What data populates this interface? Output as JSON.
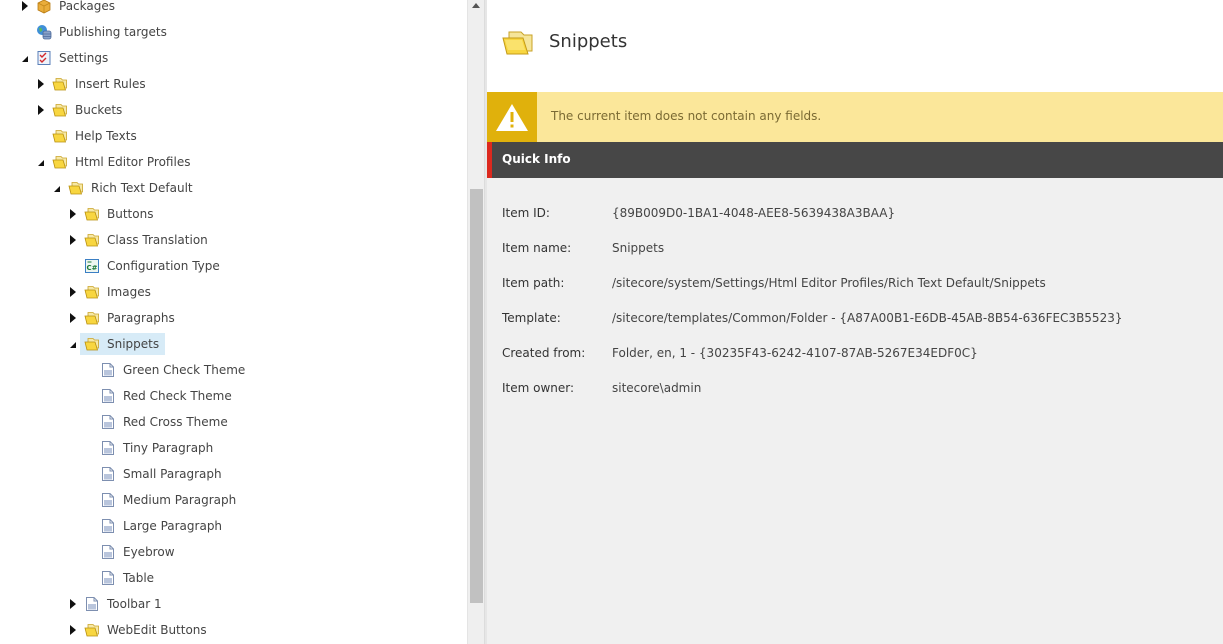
{
  "tree": {
    "items": [
      {
        "label": "Packages",
        "icon": "package-icon",
        "toggle": "collapsed",
        "level": 0
      },
      {
        "label": "Publishing targets",
        "icon": "globe-database-icon",
        "toggle": "none",
        "level": 0
      },
      {
        "label": "Settings",
        "icon": "settings-checklist-icon",
        "toggle": "expanded",
        "level": 0
      },
      {
        "label": "Insert Rules",
        "icon": "folder-icon",
        "toggle": "collapsed",
        "level": 1
      },
      {
        "label": "Buckets",
        "icon": "folder-icon",
        "toggle": "collapsed",
        "level": 1
      },
      {
        "label": "Help Texts",
        "icon": "folder-icon",
        "toggle": "none",
        "level": 1
      },
      {
        "label": "Html Editor Profiles",
        "icon": "folder-icon",
        "toggle": "expanded",
        "level": 1
      },
      {
        "label": "Rich Text Default",
        "icon": "folder-icon",
        "toggle": "expanded",
        "level": 2
      },
      {
        "label": "Buttons",
        "icon": "folder-icon",
        "toggle": "collapsed",
        "level": 3
      },
      {
        "label": "Class Translation",
        "icon": "folder-icon",
        "toggle": "collapsed",
        "level": 3
      },
      {
        "label": "Configuration Type",
        "icon": "csharp-icon",
        "toggle": "none",
        "level": 3
      },
      {
        "label": "Images",
        "icon": "folder-icon",
        "toggle": "collapsed",
        "level": 3
      },
      {
        "label": "Paragraphs",
        "icon": "folder-icon",
        "toggle": "collapsed",
        "level": 3
      },
      {
        "label": "Snippets",
        "icon": "folder-icon",
        "toggle": "expanded",
        "level": 3,
        "selected": true
      },
      {
        "label": "Green Check Theme",
        "icon": "document-icon",
        "toggle": "none",
        "level": 4
      },
      {
        "label": "Red Check Theme",
        "icon": "document-icon",
        "toggle": "none",
        "level": 4
      },
      {
        "label": "Red Cross Theme",
        "icon": "document-icon",
        "toggle": "none",
        "level": 4
      },
      {
        "label": "Tiny Paragraph",
        "icon": "document-icon",
        "toggle": "none",
        "level": 4
      },
      {
        "label": "Small Paragraph",
        "icon": "document-icon",
        "toggle": "none",
        "level": 4
      },
      {
        "label": "Medium Paragraph",
        "icon": "document-icon",
        "toggle": "none",
        "level": 4
      },
      {
        "label": "Large Paragraph",
        "icon": "document-icon",
        "toggle": "none",
        "level": 4
      },
      {
        "label": "Eyebrow",
        "icon": "document-icon",
        "toggle": "none",
        "level": 4
      },
      {
        "label": "Table",
        "icon": "document-icon",
        "toggle": "none",
        "level": 4
      },
      {
        "label": "Toolbar 1",
        "icon": "document-icon",
        "toggle": "collapsed",
        "level": 3
      },
      {
        "label": "WebEdit Buttons",
        "icon": "folder-icon",
        "toggle": "collapsed",
        "level": 3
      }
    ]
  },
  "content": {
    "title": "Snippets",
    "title_icon": "folder-icon",
    "warning": {
      "icon": "warning-icon",
      "text": "The current item does not contain any fields."
    },
    "quick_info": {
      "title": "Quick Info",
      "rows": [
        {
          "label": "Item ID:",
          "value": "{89B009D0-1BA1-4048-AEE8-5639438A3BAA}"
        },
        {
          "label": "Item name:",
          "value": "Snippets"
        },
        {
          "label": "Item path:",
          "value": "/sitecore/system/Settings/Html Editor Profiles/Rich Text Default/Snippets"
        },
        {
          "label": "Template:",
          "value": "/sitecore/templates/Common/Folder - {A87A00B1-E6DB-45AB-8B54-636FEC3B5523}"
        },
        {
          "label": "Created from:",
          "value": "Folder, en, 1 - {30235F43-6242-4107-87AB-5267E34EDF0C}"
        },
        {
          "label": "Item owner:",
          "value": "sitecore\\admin"
        }
      ]
    }
  },
  "colors": {
    "warning_bg": "#fbe79a",
    "warning_icon_bg": "#e0b10c",
    "quickinfo_bg": "#474747",
    "quickinfo_accent": "#dc291e",
    "selected_bg": "#d7ebf7"
  }
}
